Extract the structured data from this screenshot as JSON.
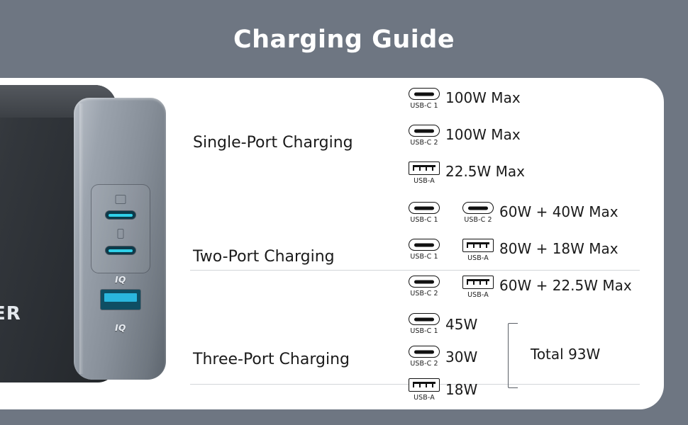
{
  "title": "Charging Guide",
  "theme": {
    "background": "#6e7682",
    "card": "#ffffff",
    "text": "#1b1b1b",
    "divider": "#d2d5d9",
    "title_color": "#ffffff",
    "port_accent": "#2ab6dd"
  },
  "product": {
    "brand_text": "ER",
    "iq_mark_top": "IQ",
    "iq_mark_bottom": "IQ"
  },
  "sections": [
    {
      "title": "Single-Port Charging",
      "rows": [
        {
          "ports": [
            {
              "type": "usb-c",
              "label": "USB-C 1"
            }
          ],
          "value": "100W Max"
        },
        {
          "ports": [
            {
              "type": "usb-c",
              "label": "USB-C 2"
            }
          ],
          "value": "100W Max"
        },
        {
          "ports": [
            {
              "type": "usb-a",
              "label": "USB-A"
            }
          ],
          "value": "22.5W Max"
        }
      ]
    },
    {
      "title": "Two-Port Charging",
      "rows": [
        {
          "ports": [
            {
              "type": "usb-c",
              "label": "USB-C 1"
            },
            {
              "type": "usb-c",
              "label": "USB-C 2"
            }
          ],
          "value": "60W + 40W Max"
        },
        {
          "ports": [
            {
              "type": "usb-c",
              "label": "USB-C 1"
            },
            {
              "type": "usb-a",
              "label": "USB-A"
            }
          ],
          "value": "80W + 18W Max"
        },
        {
          "ports": [
            {
              "type": "usb-c",
              "label": "USB-C 2"
            },
            {
              "type": "usb-a",
              "label": "USB-A"
            }
          ],
          "value": "60W + 22.5W Max"
        }
      ]
    },
    {
      "title": "Three-Port Charging",
      "total_label": "Total 93W",
      "rows": [
        {
          "ports": [
            {
              "type": "usb-c",
              "label": "USB-C 1"
            }
          ],
          "value": "45W"
        },
        {
          "ports": [
            {
              "type": "usb-c",
              "label": "USB-C 2"
            }
          ],
          "value": "30W"
        },
        {
          "ports": [
            {
              "type": "usb-a",
              "label": "USB-A"
            }
          ],
          "value": "18W"
        }
      ]
    }
  ]
}
